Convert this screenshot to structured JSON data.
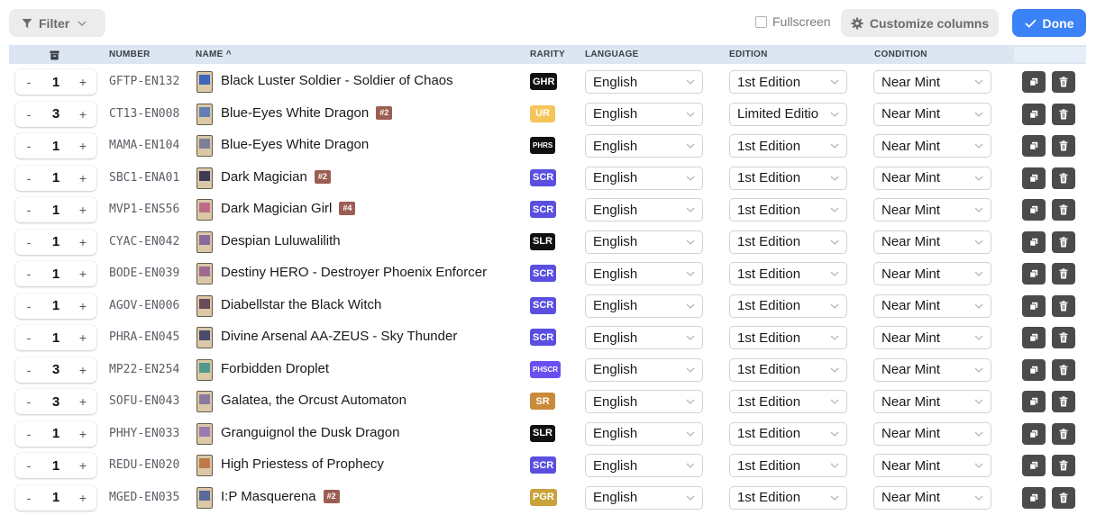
{
  "toolbar": {
    "filter_label": "Filter",
    "fullscreen_label": "Fullscreen",
    "customize_label": "Customize columns",
    "done_label": "Done",
    "accent_color": "#3b82f6"
  },
  "table": {
    "headers": {
      "number": "NUMBER",
      "name": "NAME ^",
      "rarity": "RARITY",
      "language": "LANGUAGE",
      "edition": "EDITION",
      "condition": "CONDITION"
    },
    "rows": [
      {
        "qty": "1",
        "number": "GFTP-EN132",
        "name": "Black Luster Soldier - Soldier of Chaos",
        "dup": "",
        "rarity": "GHR",
        "rarity_color": "#111111",
        "language": "English",
        "edition": "1st Edition",
        "condition": "Near Mint",
        "thumb": "#3d66b8"
      },
      {
        "qty": "3",
        "number": "CT13-EN008",
        "name": "Blue-Eyes White Dragon",
        "dup": "#2",
        "rarity": "UR",
        "rarity_color": "#f5c55a",
        "language": "English",
        "edition": "Limited Editio",
        "condition": "Near Mint",
        "thumb": "#5f7fb5"
      },
      {
        "qty": "1",
        "number": "MAMA-EN104",
        "name": "Blue-Eyes White Dragon",
        "dup": "",
        "rarity": "PHRS",
        "rarity_color": "#111111",
        "language": "English",
        "edition": "1st Edition",
        "condition": "Near Mint",
        "thumb": "#7d7f98"
      },
      {
        "qty": "1",
        "number": "SBC1-ENA01",
        "name": "Dark Magician",
        "dup": "#2",
        "rarity": "SCR",
        "rarity_color": "#5a4fe0",
        "language": "English",
        "edition": "1st Edition",
        "condition": "Near Mint",
        "thumb": "#3f3a52"
      },
      {
        "qty": "1",
        "number": "MVP1-ENS56",
        "name": "Dark Magician Girl",
        "dup": "#4",
        "rarity": "SCR",
        "rarity_color": "#5a4fe0",
        "language": "English",
        "edition": "1st Edition",
        "condition": "Near Mint",
        "thumb": "#c06a8a"
      },
      {
        "qty": "1",
        "number": "CYAC-EN042",
        "name": "Despian Luluwalilith",
        "dup": "",
        "rarity": "SLR",
        "rarity_color": "#111111",
        "language": "English",
        "edition": "1st Edition",
        "condition": "Near Mint",
        "thumb": "#8a6a9a"
      },
      {
        "qty": "1",
        "number": "BODE-EN039",
        "name": "Destiny HERO - Destroyer Phoenix Enforcer",
        "dup": "",
        "rarity": "SCR",
        "rarity_color": "#5a4fe0",
        "language": "English",
        "edition": "1st Edition",
        "condition": "Near Mint",
        "thumb": "#a06a92"
      },
      {
        "qty": "1",
        "number": "AGOV-EN006",
        "name": "Diabellstar the Black Witch",
        "dup": "",
        "rarity": "SCR",
        "rarity_color": "#5a4fe0",
        "language": "English",
        "edition": "1st Edition",
        "condition": "Near Mint",
        "thumb": "#6a4a5a"
      },
      {
        "qty": "1",
        "number": "PHRA-EN045",
        "name": "Divine Arsenal AA-ZEUS - Sky Thunder",
        "dup": "",
        "rarity": "SCR",
        "rarity_color": "#5a4fe0",
        "language": "English",
        "edition": "1st Edition",
        "condition": "Near Mint",
        "thumb": "#4a4a6a"
      },
      {
        "qty": "3",
        "number": "MP22-EN254",
        "name": "Forbidden Droplet",
        "dup": "",
        "rarity": "PHSCR",
        "rarity_color": "#6a4ff0",
        "language": "English",
        "edition": "1st Edition",
        "condition": "Near Mint",
        "thumb": "#4f9a8a"
      },
      {
        "qty": "3",
        "number": "SOFU-EN043",
        "name": "Galatea, the Orcust Automaton",
        "dup": "",
        "rarity": "SR",
        "rarity_color": "#c98a3a",
        "language": "English",
        "edition": "1st Edition",
        "condition": "Near Mint",
        "thumb": "#8a7aa0"
      },
      {
        "qty": "1",
        "number": "PHHY-EN033",
        "name": "Granguignol the Dusk Dragon",
        "dup": "",
        "rarity": "SLR",
        "rarity_color": "#111111",
        "language": "English",
        "edition": "1st Edition",
        "condition": "Near Mint",
        "thumb": "#9a7ab0"
      },
      {
        "qty": "1",
        "number": "REDU-EN020",
        "name": "High Priestess of Prophecy",
        "dup": "",
        "rarity": "SCR",
        "rarity_color": "#5a4fe0",
        "language": "English",
        "edition": "1st Edition",
        "condition": "Near Mint",
        "thumb": "#c07a4a"
      },
      {
        "qty": "1",
        "number": "MGED-EN035",
        "name": "I:P Masquerena",
        "dup": "#2",
        "rarity": "PGR",
        "rarity_color": "#c9a23a",
        "language": "English",
        "edition": "1st Edition",
        "condition": "Near Mint",
        "thumb": "#5a6a9a"
      }
    ]
  },
  "icons": {
    "filter": "filter-icon",
    "chevron": "chevron-down-icon",
    "gear": "gear-icon",
    "check": "check-icon",
    "archive": "archive-icon",
    "copy": "copy-icon",
    "trash": "trash-icon"
  }
}
